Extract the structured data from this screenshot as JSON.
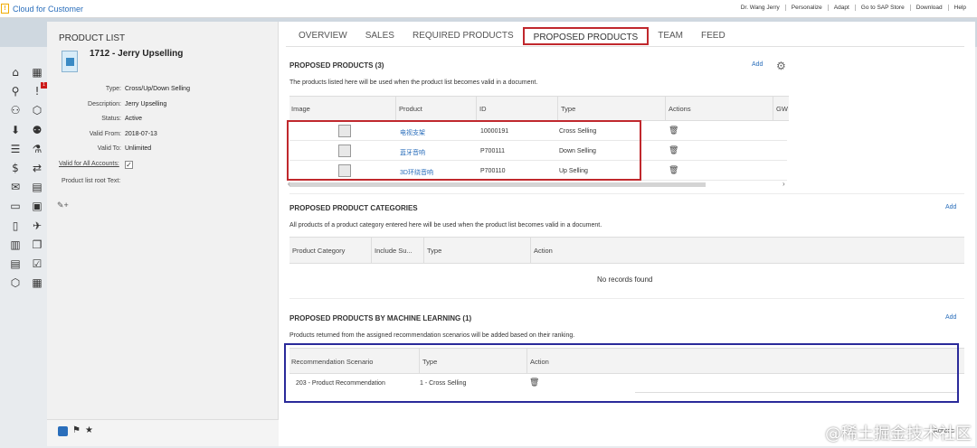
{
  "app": {
    "logo_glyph": "!",
    "title": "Cloud for Customer"
  },
  "top_links": [
    "Dr. Wang Jerry",
    "Personalize",
    "Adapt",
    "Go to SAP Store",
    "Download",
    "Help"
  ],
  "left_nav": {
    "badge_count": "1",
    "icons": [
      "home-icon",
      "calendar-icon",
      "search-icon",
      "alert-icon",
      "org-icon",
      "box-icon",
      "download-icon",
      "person-icon",
      "list-icon",
      "analytics-icon",
      "dollar-icon",
      "transfer-icon",
      "chat-icon",
      "table-icon",
      "tablet-icon",
      "doc-dollar-icon",
      "device-icon",
      "map-icon",
      "report-icon",
      "copy-icon",
      "form-icon",
      "checklist-icon",
      "cube-icon",
      "notes-icon"
    ],
    "glyphs": [
      "⌂",
      "▦",
      "⚲",
      "!",
      "⚇",
      "⬡",
      "⬇",
      "⚉",
      "☰",
      "⚗",
      "$",
      "⇄",
      "✉",
      "▤",
      "▭",
      "▣",
      "▯",
      "✈",
      "▥",
      "❐",
      "▤",
      "☑",
      "⬡",
      "▦"
    ]
  },
  "product_list": {
    "heading": "PRODUCT LIST",
    "name": "1712 - Jerry Upselling",
    "fields": [
      {
        "label": "Type:",
        "value": "Cross/Up/Down Selling"
      },
      {
        "label": "Description:",
        "value": "Jerry Upselling"
      },
      {
        "label": "Status:",
        "value": "Active"
      },
      {
        "label": "Valid From:",
        "value": "2018-07-13"
      },
      {
        "label": "Valid To:",
        "value": "Unlimited"
      }
    ],
    "valid_all_label": "Valid for All Accounts:",
    "valid_all_check": "✓",
    "root_text_label": "Product list root Text:",
    "tags_glyph": "✎+"
  },
  "tabs": [
    "OVERVIEW",
    "SALES",
    "REQUIRED PRODUCTS",
    "PROPOSED PRODUCTS",
    "TEAM",
    "FEED"
  ],
  "proposed_products": {
    "title": "PROPOSED PRODUCTS (3)",
    "add_label": "Add",
    "gear_glyph": "⚙",
    "description": "The products listed here will be used when the product list becomes valid in a document.",
    "columns": [
      "Image",
      "Product",
      "ID",
      "Type",
      "Actions",
      "GW"
    ],
    "rows": [
      {
        "product": "电视支架",
        "id": "10000191",
        "type": "Cross Selling"
      },
      {
        "product": "蓝牙音响",
        "id": "P700111",
        "type": "Down Selling"
      },
      {
        "product": "3D环绕音响",
        "id": "P700110",
        "type": "Up Selling"
      }
    ],
    "trash_glyph": "🗑",
    "scroll_left": "‹",
    "scroll_right": "›"
  },
  "categories": {
    "title": "PROPOSED PRODUCT CATEGORIES",
    "add_label": "Add",
    "description": "All products of a product category entered here will be used when the product list becomes valid in a document.",
    "columns": [
      "Product Category",
      "Include Su...",
      "Type",
      "Action"
    ],
    "empty_text": "No records found"
  },
  "ml": {
    "title": "PROPOSED PRODUCTS BY MACHINE LEARNING (1)",
    "add_label": "Add",
    "description": "Products returned from the assigned recommendation scenarios will be added based on their ranking.",
    "columns": [
      "Recommendation Scenario",
      "Type",
      "Action"
    ],
    "rows": [
      {
        "scenario": "203 - Product Recommendation",
        "type": "1 - Cross Selling"
      }
    ]
  },
  "footer": {
    "flag_glyph": "⚑",
    "star_glyph": "★"
  },
  "watermark": {
    "text": "@稀土掘金技术社区",
    "extra": "Actions"
  },
  "colors": {
    "accent": "#2a6ebb",
    "red_highlight": "#c0282d",
    "blue_highlight": "#2a2a9a"
  }
}
